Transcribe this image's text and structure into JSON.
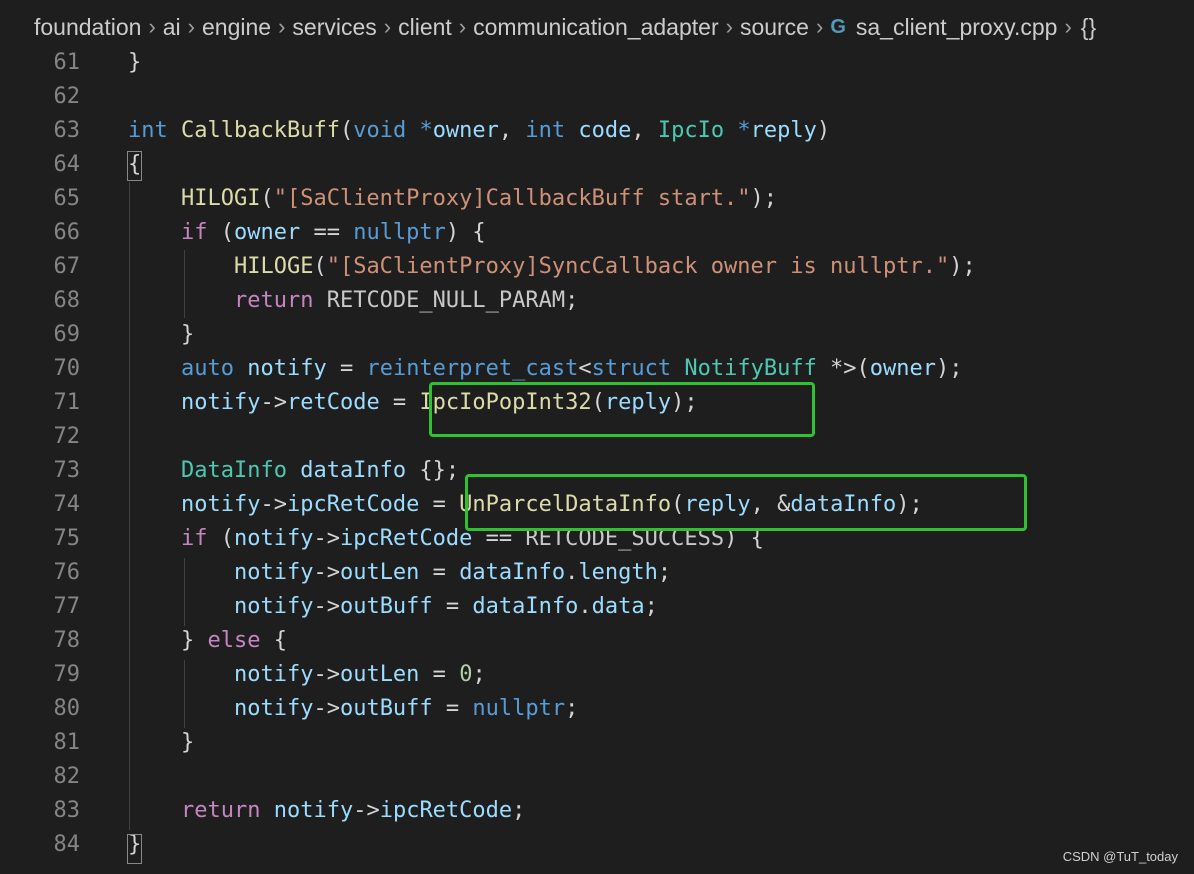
{
  "breadcrumb": {
    "segments": [
      "foundation",
      "ai",
      "engine",
      "services",
      "client",
      "communication_adapter",
      "source"
    ],
    "file_icon": "cpp-file-icon",
    "file_icon_glyph": "G",
    "file": "sa_client_proxy.cpp",
    "symbol_icon": "braces-icon",
    "symbol_glyph": "{}"
  },
  "code": {
    "lines": [
      {
        "n": "61",
        "tokens": [
          [
            "p",
            "}"
          ]
        ]
      },
      {
        "n": "62",
        "tokens": []
      },
      {
        "n": "63",
        "tokens": [
          [
            "kw",
            "int"
          ],
          [
            "p",
            " "
          ],
          [
            "fn",
            "CallbackBuff"
          ],
          [
            "p",
            "("
          ],
          [
            "kw",
            "void"
          ],
          [
            "p",
            " "
          ],
          [
            "kw",
            "*"
          ],
          [
            "var",
            "owner"
          ],
          [
            "p",
            ", "
          ],
          [
            "kw",
            "int"
          ],
          [
            "p",
            " "
          ],
          [
            "var",
            "code"
          ],
          [
            "p",
            ", "
          ],
          [
            "ty",
            "IpcIo"
          ],
          [
            "p",
            " "
          ],
          [
            "kw",
            "*"
          ],
          [
            "var",
            "reply"
          ],
          [
            "p",
            ")"
          ]
        ]
      },
      {
        "n": "64",
        "tokens": [
          [
            "p",
            "{"
          ]
        ]
      },
      {
        "n": "65",
        "tokens": [
          [
            "p",
            "    "
          ],
          [
            "fn",
            "HILOGI"
          ],
          [
            "p",
            "("
          ],
          [
            "str",
            "\"[SaClientProxy]CallbackBuff start.\""
          ],
          [
            "p",
            ");"
          ]
        ]
      },
      {
        "n": "66",
        "tokens": [
          [
            "p",
            "    "
          ],
          [
            "ctl",
            "if"
          ],
          [
            "p",
            " ("
          ],
          [
            "var",
            "owner"
          ],
          [
            "p",
            " == "
          ],
          [
            "kw",
            "nullptr"
          ],
          [
            "p",
            ") {"
          ]
        ]
      },
      {
        "n": "67",
        "tokens": [
          [
            "p",
            "        "
          ],
          [
            "fn",
            "HILOGE"
          ],
          [
            "p",
            "("
          ],
          [
            "str",
            "\"[SaClientProxy]SyncCallback owner is nullptr.\""
          ],
          [
            "p",
            ");"
          ]
        ]
      },
      {
        "n": "68",
        "tokens": [
          [
            "p",
            "        "
          ],
          [
            "ctl",
            "return"
          ],
          [
            "p",
            " "
          ],
          [
            "mac",
            "RETCODE_NULL_PARAM"
          ],
          [
            "p",
            ";"
          ]
        ]
      },
      {
        "n": "69",
        "tokens": [
          [
            "p",
            "    }"
          ]
        ]
      },
      {
        "n": "70",
        "tokens": [
          [
            "p",
            "    "
          ],
          [
            "kw",
            "auto"
          ],
          [
            "p",
            " "
          ],
          [
            "var",
            "notify"
          ],
          [
            "p",
            " = "
          ],
          [
            "kw",
            "reinterpret_cast"
          ],
          [
            "p",
            "<"
          ],
          [
            "kw",
            "struct"
          ],
          [
            "p",
            " "
          ],
          [
            "ty",
            "NotifyBuff"
          ],
          [
            "p",
            " *>("
          ],
          [
            "var",
            "owner"
          ],
          [
            "p",
            ");"
          ]
        ]
      },
      {
        "n": "71",
        "tokens": [
          [
            "p",
            "    "
          ],
          [
            "var",
            "notify"
          ],
          [
            "p",
            "->"
          ],
          [
            "var",
            "retCode"
          ],
          [
            "p",
            " = "
          ],
          [
            "fn",
            "IpcIoPopInt32"
          ],
          [
            "p",
            "("
          ],
          [
            "var",
            "reply"
          ],
          [
            "p",
            ");"
          ]
        ]
      },
      {
        "n": "72",
        "tokens": []
      },
      {
        "n": "73",
        "tokens": [
          [
            "p",
            "    "
          ],
          [
            "ty",
            "DataInfo"
          ],
          [
            "p",
            " "
          ],
          [
            "var",
            "dataInfo"
          ],
          [
            "p",
            " {};"
          ]
        ]
      },
      {
        "n": "74",
        "tokens": [
          [
            "p",
            "    "
          ],
          [
            "var",
            "notify"
          ],
          [
            "p",
            "->"
          ],
          [
            "var",
            "ipcRetCode"
          ],
          [
            "p",
            " = "
          ],
          [
            "fn",
            "UnParcelDataInfo"
          ],
          [
            "p",
            "("
          ],
          [
            "var",
            "reply"
          ],
          [
            "p",
            ", &"
          ],
          [
            "var",
            "dataInfo"
          ],
          [
            "p",
            ");"
          ]
        ]
      },
      {
        "n": "75",
        "tokens": [
          [
            "p",
            "    "
          ],
          [
            "ctl",
            "if"
          ],
          [
            "p",
            " ("
          ],
          [
            "var",
            "notify"
          ],
          [
            "p",
            "->"
          ],
          [
            "var",
            "ipcRetCode"
          ],
          [
            "p",
            " == "
          ],
          [
            "mac",
            "RETCODE_SUCCESS"
          ],
          [
            "p",
            ") {"
          ]
        ]
      },
      {
        "n": "76",
        "tokens": [
          [
            "p",
            "        "
          ],
          [
            "var",
            "notify"
          ],
          [
            "p",
            "->"
          ],
          [
            "var",
            "outLen"
          ],
          [
            "p",
            " = "
          ],
          [
            "var",
            "dataInfo"
          ],
          [
            "p",
            "."
          ],
          [
            "var",
            "length"
          ],
          [
            "p",
            ";"
          ]
        ]
      },
      {
        "n": "77",
        "tokens": [
          [
            "p",
            "        "
          ],
          [
            "var",
            "notify"
          ],
          [
            "p",
            "->"
          ],
          [
            "var",
            "outBuff"
          ],
          [
            "p",
            " = "
          ],
          [
            "var",
            "dataInfo"
          ],
          [
            "p",
            "."
          ],
          [
            "var",
            "data"
          ],
          [
            "p",
            ";"
          ]
        ]
      },
      {
        "n": "78",
        "tokens": [
          [
            "p",
            "    } "
          ],
          [
            "ctl",
            "else"
          ],
          [
            "p",
            " {"
          ]
        ]
      },
      {
        "n": "79",
        "tokens": [
          [
            "p",
            "        "
          ],
          [
            "var",
            "notify"
          ],
          [
            "p",
            "->"
          ],
          [
            "var",
            "outLen"
          ],
          [
            "p",
            " = "
          ],
          [
            "num",
            "0"
          ],
          [
            "p",
            ";"
          ]
        ]
      },
      {
        "n": "80",
        "tokens": [
          [
            "p",
            "        "
          ],
          [
            "var",
            "notify"
          ],
          [
            "p",
            "->"
          ],
          [
            "var",
            "outBuff"
          ],
          [
            "p",
            " = "
          ],
          [
            "kw",
            "nullptr"
          ],
          [
            "p",
            ";"
          ]
        ]
      },
      {
        "n": "81",
        "tokens": [
          [
            "p",
            "    }"
          ]
        ]
      },
      {
        "n": "82",
        "tokens": []
      },
      {
        "n": "83",
        "tokens": [
          [
            "p",
            "    "
          ],
          [
            "ctl",
            "return"
          ],
          [
            "p",
            " "
          ],
          [
            "var",
            "notify"
          ],
          [
            "p",
            "->"
          ],
          [
            "var",
            "ipcRetCode"
          ],
          [
            "p",
            ";"
          ]
        ]
      },
      {
        "n": "84",
        "tokens": [
          [
            "p",
            "}"
          ]
        ]
      }
    ]
  },
  "highlight_color": "#2ec230",
  "watermark": "CSDN @TuT_today"
}
